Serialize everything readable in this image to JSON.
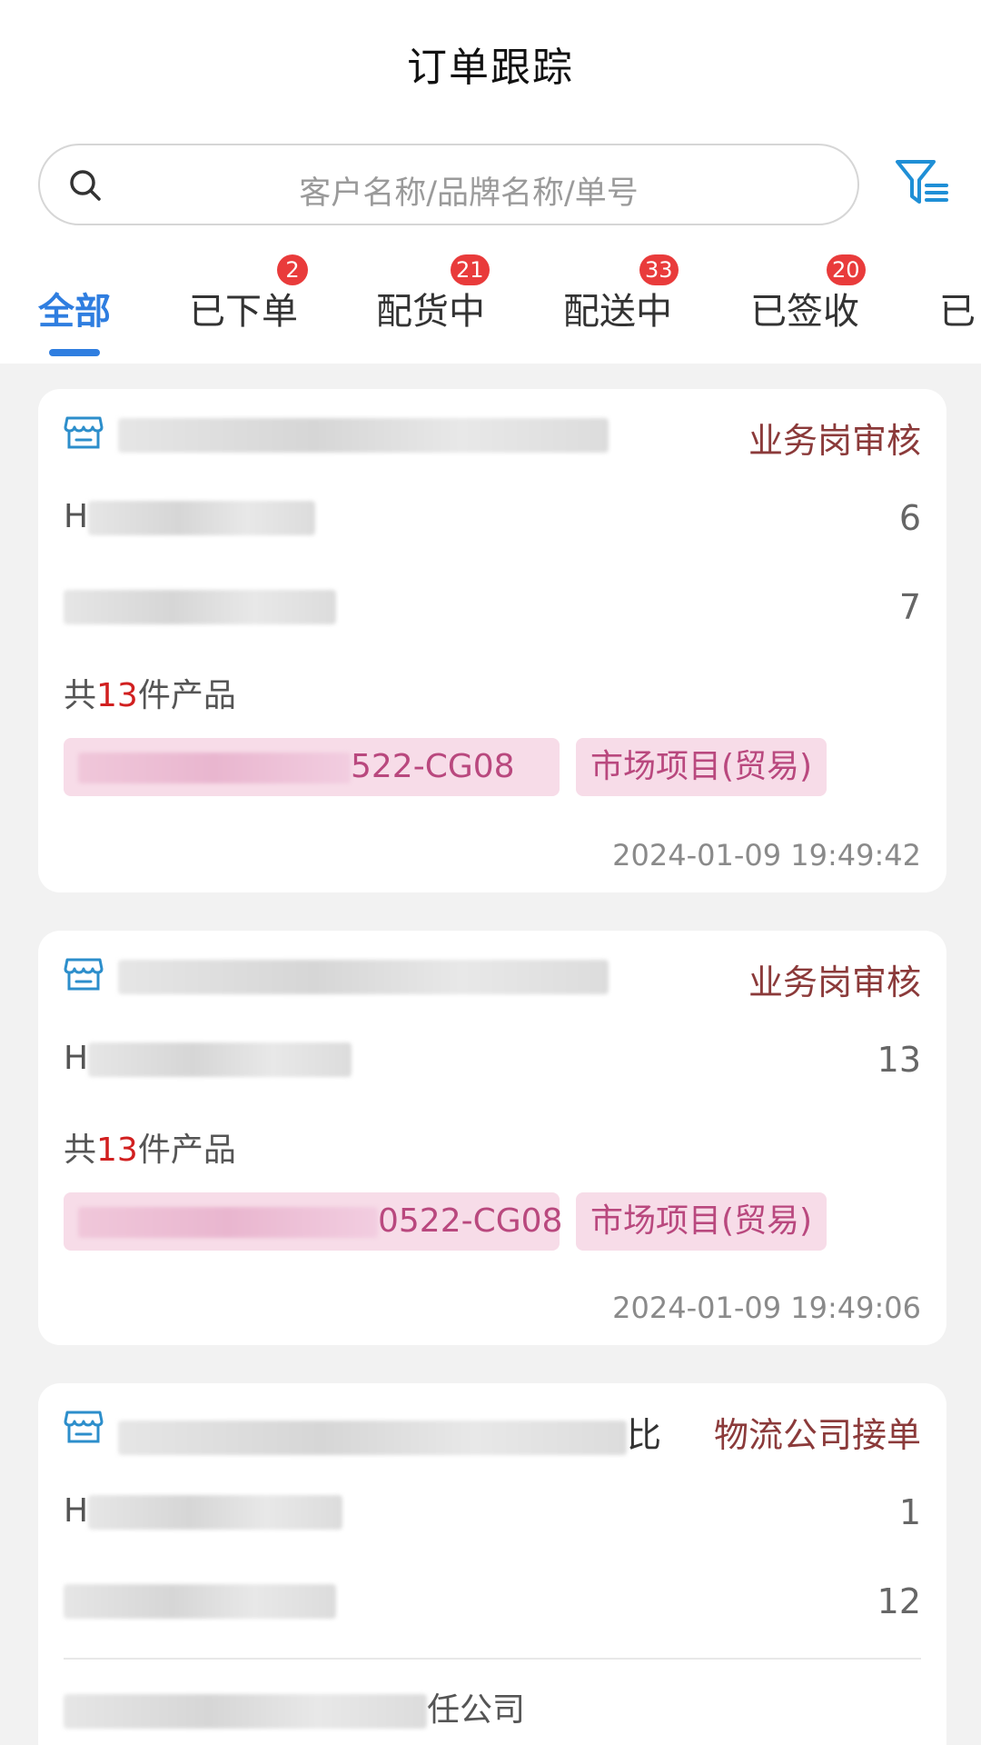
{
  "header": {
    "title": "订单跟踪"
  },
  "search": {
    "placeholder": "客户名称/品牌名称/单号"
  },
  "tabs": [
    {
      "label": "全部",
      "badge": ""
    },
    {
      "label": "已下单",
      "badge": "2"
    },
    {
      "label": "配货中",
      "badge": "21"
    },
    {
      "label": "配送中",
      "badge": "33"
    },
    {
      "label": "已签收",
      "badge": "20"
    },
    {
      "label": "已",
      "badge": ""
    }
  ],
  "orders": [
    {
      "store_name_visible": "",
      "status": "业务岗审核",
      "items": [
        {
          "name_visible": "H",
          "qty": "6"
        },
        {
          "name_visible": "",
          "qty": "7"
        }
      ],
      "total_prefix": "共",
      "total_count": "13",
      "total_suffix": "件产品",
      "tag_code_visible": "522-CG08",
      "tag_project": "市场项目(贸易)",
      "time": "2024-01-09 19:49:42"
    },
    {
      "store_name_visible": "",
      "status": "业务岗审核",
      "items": [
        {
          "name_visible": "H",
          "qty": "13"
        }
      ],
      "total_prefix": "共",
      "total_count": "13",
      "total_suffix": "件产品",
      "tag_code_visible": "0522-CG08",
      "tag_project": "市场项目(贸易)",
      "time": "2024-01-09 19:49:06"
    },
    {
      "store_name_visible": "比",
      "status": "物流公司接单",
      "items": [
        {
          "name_visible": "H",
          "qty": "1"
        },
        {
          "name_visible": "",
          "qty": "12"
        }
      ],
      "company_visible": "任公司"
    }
  ]
}
